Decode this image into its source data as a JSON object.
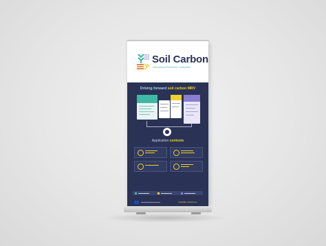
{
  "logo": {
    "title": "Soil Carbon",
    "subtitle": "International Research Consortium"
  },
  "section1": {
    "heading_pre": "Driving forward ",
    "heading_highlight": "soil carbon MRV"
  },
  "section2": {
    "heading_pre": "Application ",
    "heading_highlight": "contexts"
  },
  "footer": {
    "contact": "contact@irc-soilcarbon.eu"
  },
  "colors": {
    "navy": "#2a3255",
    "teal": "#3fb8a4",
    "yellow": "#f2d12a",
    "purple": "#8a7fd0",
    "backdrop": "#e6e6e6"
  }
}
